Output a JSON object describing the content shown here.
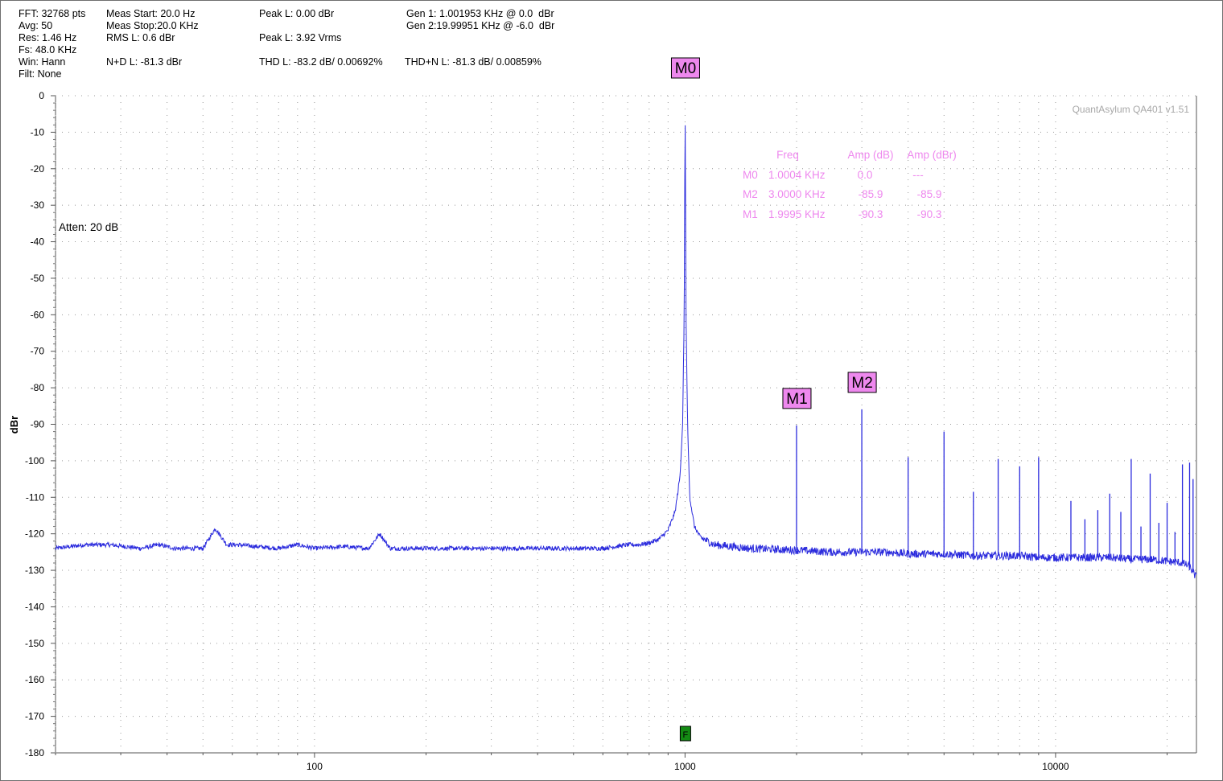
{
  "header": {
    "fft": "FFT: 32768 pts",
    "avg": "Avg: 50",
    "res": "Res: 1.46 Hz",
    "fs": "Fs: 48.0 KHz",
    "win": "Win: Hann",
    "filt": "Filt: None",
    "meas_start": "Meas Start: 20.0 Hz",
    "meas_stop": "Meas Stop:20.0 KHz",
    "rms_l": "RMS L: 0.6 dBr",
    "nd_l": "N+D L: -81.3 dBr",
    "peak_l_dbr": "Peak L: 0.00 dBr",
    "peak_l_vrms": "Peak L: 3.92 Vrms",
    "thd_l": "THD L: -83.2 dB/ 0.00692%",
    "gen1": "Gen 1: 1.001953 KHz @ 0.0  dBr",
    "gen2": "Gen 2:19.99951 KHz @ -6.0  dBr",
    "thdn_l": "THD+N L: -81.3 dB/ 0.00859%"
  },
  "watermark": "QuantAsylum QA401 v1.51",
  "atten": "Atten: 20 dB",
  "marker_table": {
    "headers": [
      "Freq",
      "Amp (dB)",
      "Amp (dBr)"
    ],
    "rows": [
      {
        "marker": "M0",
        "freq": "1.0004 KHz",
        "amp_db": "0.0",
        "amp_dbr": "---"
      },
      {
        "marker": "M2",
        "freq": "3.0000 KHz",
        "amp_db": "-85.9",
        "amp_dbr": "-85.9"
      },
      {
        "marker": "M1",
        "freq": "1.9995 KHz",
        "amp_db": "-90.3",
        "amp_dbr": "-90.3"
      }
    ]
  },
  "colors": {
    "trace": "#2b2bdd",
    "marker": "#ee88ee",
    "grid": "#9a9a9a",
    "f_marker": "#138a13"
  },
  "chart_data": {
    "type": "line",
    "xscale": "log",
    "xlim": [
      20,
      24000
    ],
    "ylim": [
      -180,
      0
    ],
    "ylabel": "dBr",
    "xlabel": "",
    "x_ticks": [
      100,
      1000,
      10000
    ],
    "x_tick_labels": [
      "100",
      "1000",
      "10000"
    ],
    "y_ticks": [
      0,
      -10,
      -20,
      -30,
      -40,
      -50,
      -60,
      -70,
      -80,
      -90,
      -100,
      -110,
      -120,
      -130,
      -140,
      -150,
      -160,
      -170,
      -180
    ],
    "y_tick_labels": [
      "0",
      "-10",
      "-20",
      "-30",
      "-40",
      "-50",
      "-60",
      "-70",
      "-80",
      "-90",
      "-100",
      "-110",
      "-120",
      "-130",
      "-140",
      "-150",
      "-160",
      "-170",
      "-180"
    ],
    "grid": true,
    "series": [
      {
        "x": [
          20,
          24,
          28,
          34,
          38,
          42,
          46,
          50,
          54,
          58,
          62,
          70,
          80,
          90,
          100,
          120,
          140,
          150,
          160,
          200,
          250,
          300,
          400,
          500,
          600,
          700,
          750,
          800,
          850,
          900,
          940,
          970,
          985,
          995,
          1000.4,
          1006,
          1016,
          1030,
          1060,
          1100,
          1200,
          1500,
          1999.5,
          2500,
          2999.5,
          3500,
          4000,
          4500,
          5000,
          6000,
          7000,
          8000,
          9000,
          10000,
          12000,
          14000,
          16000,
          18000,
          20000,
          22000,
          23000,
          24000
        ],
        "y": [
          -124,
          -123,
          -123,
          -124,
          -123,
          -124,
          -124,
          -124,
          -118.5,
          -123,
          -123,
          -123.5,
          -124,
          -123,
          -124,
          -123.5,
          -124,
          -120,
          -124,
          -124,
          -124,
          -124,
          -124,
          -124,
          -124,
          -123,
          -123,
          -122.5,
          -121.5,
          -119,
          -114,
          -104,
          -90,
          -60,
          0,
          -60,
          -90,
          -110,
          -118,
          -121,
          -123,
          -124,
          -124.5,
          -125,
          -125,
          -125,
          -125.5,
          -125.5,
          -125.5,
          -126,
          -126,
          -126,
          -126.5,
          -126.5,
          -126.5,
          -126.5,
          -127,
          -127,
          -127.5,
          -128,
          -129,
          -132
        ]
      }
    ],
    "harmonic_spurs": [
      {
        "x": 1999.5,
        "y": -90.3
      },
      {
        "x": 2999.5,
        "y": -85.9
      },
      {
        "x": 4000,
        "y": -99
      },
      {
        "x": 5000,
        "y": -92
      },
      {
        "x": 6000,
        "y": -108.5
      },
      {
        "x": 7000,
        "y": -99.5
      },
      {
        "x": 8000,
        "y": -101.5
      },
      {
        "x": 9000,
        "y": -99
      },
      {
        "x": 11000,
        "y": -111
      },
      {
        "x": 12000,
        "y": -116
      },
      {
        "x": 13000,
        "y": -113.5
      },
      {
        "x": 14000,
        "y": -109
      },
      {
        "x": 15000,
        "y": -114
      },
      {
        "x": 16000,
        "y": -99.5
      },
      {
        "x": 17000,
        "y": -118
      },
      {
        "x": 18000,
        "y": -103.5
      },
      {
        "x": 19000,
        "y": -117
      },
      {
        "x": 20000,
        "y": -111.5
      },
      {
        "x": 21000,
        "y": -119.5
      },
      {
        "x": 22000,
        "y": -101
      },
      {
        "x": 23000,
        "y": -100.5
      },
      {
        "x": 23500,
        "y": -105
      }
    ],
    "markers": [
      {
        "label": "M0",
        "x": 1000.4,
        "y": 0.0
      },
      {
        "label": "M1",
        "x": 1999.5,
        "y": -90.3
      },
      {
        "label": "M2",
        "x": 2999.5,
        "y": -85.9
      }
    ],
    "f_marker": {
      "label": "F",
      "x": 1000
    }
  }
}
